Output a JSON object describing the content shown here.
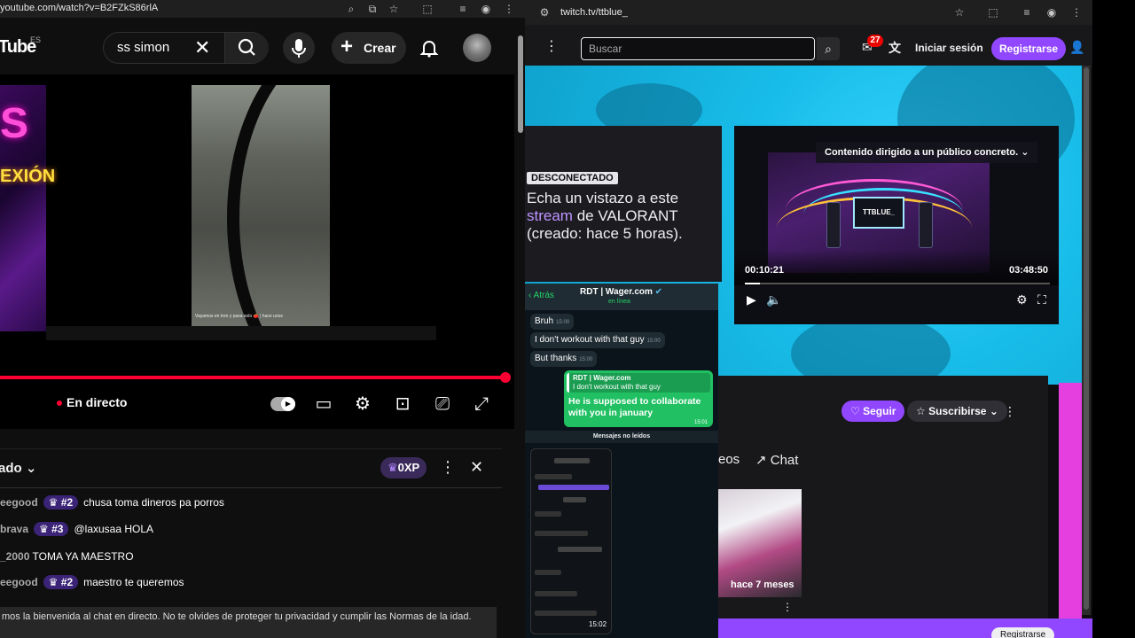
{
  "youtube": {
    "url": "youtube.com/watch?v=B2FZkS86rlA",
    "logo": "Tube",
    "region": "ES",
    "search_query": "ss simon",
    "create_label": "Crear",
    "live_label": "En directo",
    "video_caption": "Vayamos en tren y pasa solo 🍅 | hace unos",
    "neon_text": "S",
    "neon_text2": "EXIÓN",
    "chat": {
      "header": "ado",
      "xp_label": "0XP",
      "messages": [
        {
          "user": "eegood",
          "badge": "#2",
          "text": "chusa toma dineros pa porros"
        },
        {
          "user": "brava",
          "badge": "#3",
          "text": "@laxusaa HOLA"
        },
        {
          "user": "_2000",
          "badge": "",
          "text": "TOMA YA MAESTRO"
        },
        {
          "user": "eegood",
          "badge": "#2",
          "text": "maestro te queremos"
        }
      ],
      "welcome": "mos la bienvenida al chat en directo. No te olvides de proteger tu privacidad y cumplir las Normas de la idad."
    }
  },
  "twitch": {
    "url": "twitch.tv/ttblue_",
    "search_placeholder": "Buscar",
    "notif_count": "27",
    "login_label": "Iniciar sesión",
    "signup_label": "Registrarse",
    "offline_tag": "DESCONECTADO",
    "offline_text_1": "Echa un vistazo a este ",
    "offline_highlight": "stream",
    "offline_text_2": " de VALORANT (creado: hace 5 horas).",
    "player_notice": "Contenido dirigido a un público concreto.",
    "stage_screen": "TTBLUE_",
    "time_current": "00:10:21",
    "time_total": "03:48:50",
    "progress": 0.05,
    "follow_label": "Seguir",
    "subscribe_label": "Suscribirse",
    "tab_videos": "eos",
    "tab_chat": "Chat",
    "thumb_ago": "hace 7 meses",
    "footer_signup": "Registrarse"
  },
  "whatsapp": {
    "back_label": "Atrás",
    "contact": "RDT | Wager.com",
    "status": "en línea",
    "messages": [
      {
        "text": "Bruh",
        "time": "15:00"
      },
      {
        "text": "I don't workout with that guy",
        "time": "15:00"
      },
      {
        "text": "But thanks",
        "time": "15:00"
      }
    ],
    "reply_quote_name": "RDT | Wager.com",
    "reply_quote_text": "I don't workout with that guy",
    "reply_text": "He is supposed to collaborate with you in january",
    "reply_time": "15:01",
    "unread_label": "Mensajes no leídos",
    "footer_time": "15:02"
  }
}
